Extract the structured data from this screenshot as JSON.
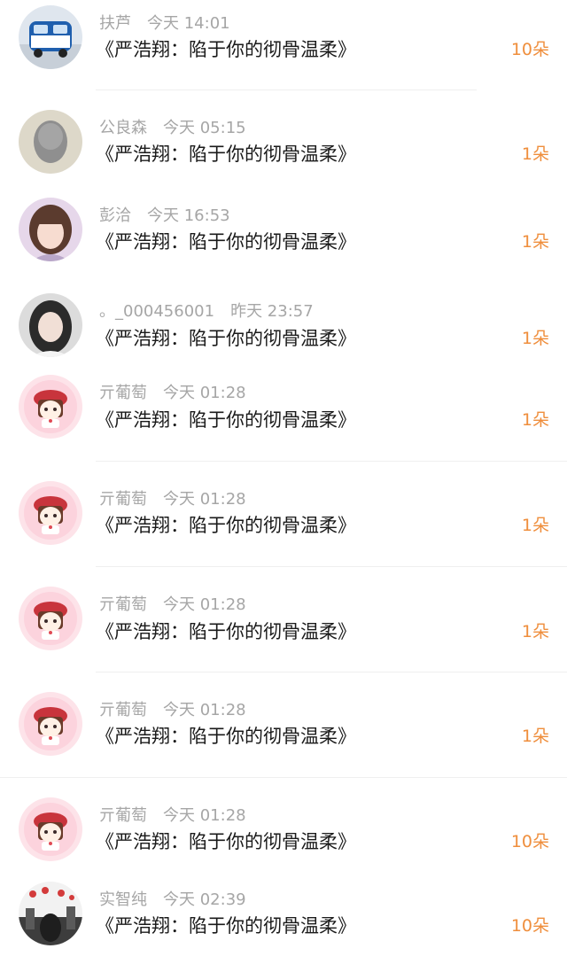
{
  "colors": {
    "accent": "#ef8e3c",
    "name_text": "#a6a6a6",
    "title_text": "#1a1a1a",
    "divider": "#efefef"
  },
  "entries": [
    {
      "name": "扶芦",
      "time": "今天 14:01",
      "title": "《严浩翔：陷于你的彻骨温柔》",
      "amount": "10朵",
      "avatar": "bus-photo"
    },
    {
      "name": "公良森",
      "time": "今天 05:15",
      "title": "《严浩翔：陷于你的彻骨温柔》",
      "amount": "1朵",
      "avatar": "blurred-portrait"
    },
    {
      "name": "彭洽",
      "time": "今天 16:53",
      "title": "《严浩翔：陷于你的彻骨温柔》",
      "amount": "1朵",
      "avatar": "girl-photo"
    },
    {
      "name": "。_000456001",
      "time": "昨天 23:57",
      "title": "《严浩翔：陷于你的彻骨温柔》",
      "amount": "1朵",
      "avatar": "girl-photo-2"
    },
    {
      "name": "亓葡萄",
      "time": "今天 01:28",
      "title": "《严浩翔：陷于你的彻骨温柔》",
      "amount": "1朵",
      "avatar": "cartoon-boy"
    },
    {
      "name": "亓葡萄",
      "time": "今天 01:28",
      "title": "《严浩翔：陷于你的彻骨温柔》",
      "amount": "1朵",
      "avatar": "cartoon-boy"
    },
    {
      "name": "亓葡萄",
      "time": "今天 01:28",
      "title": "《严浩翔：陷于你的彻骨温柔》",
      "amount": "1朵",
      "avatar": "cartoon-boy"
    },
    {
      "name": "亓葡萄",
      "time": "今天 01:28",
      "title": "《严浩翔：陷于你的彻骨温柔》",
      "amount": "1朵",
      "avatar": "cartoon-boy"
    },
    {
      "name": "亓葡萄",
      "time": "今天 01:28",
      "title": "《严浩翔：陷于你的彻骨温柔》",
      "amount": "10朵",
      "avatar": "cartoon-boy"
    },
    {
      "name": "实智纯",
      "time": "今天 02:39",
      "title": "《严浩翔：陷于你的彻骨温柔》",
      "amount": "10朵",
      "avatar": "street-photo"
    }
  ]
}
